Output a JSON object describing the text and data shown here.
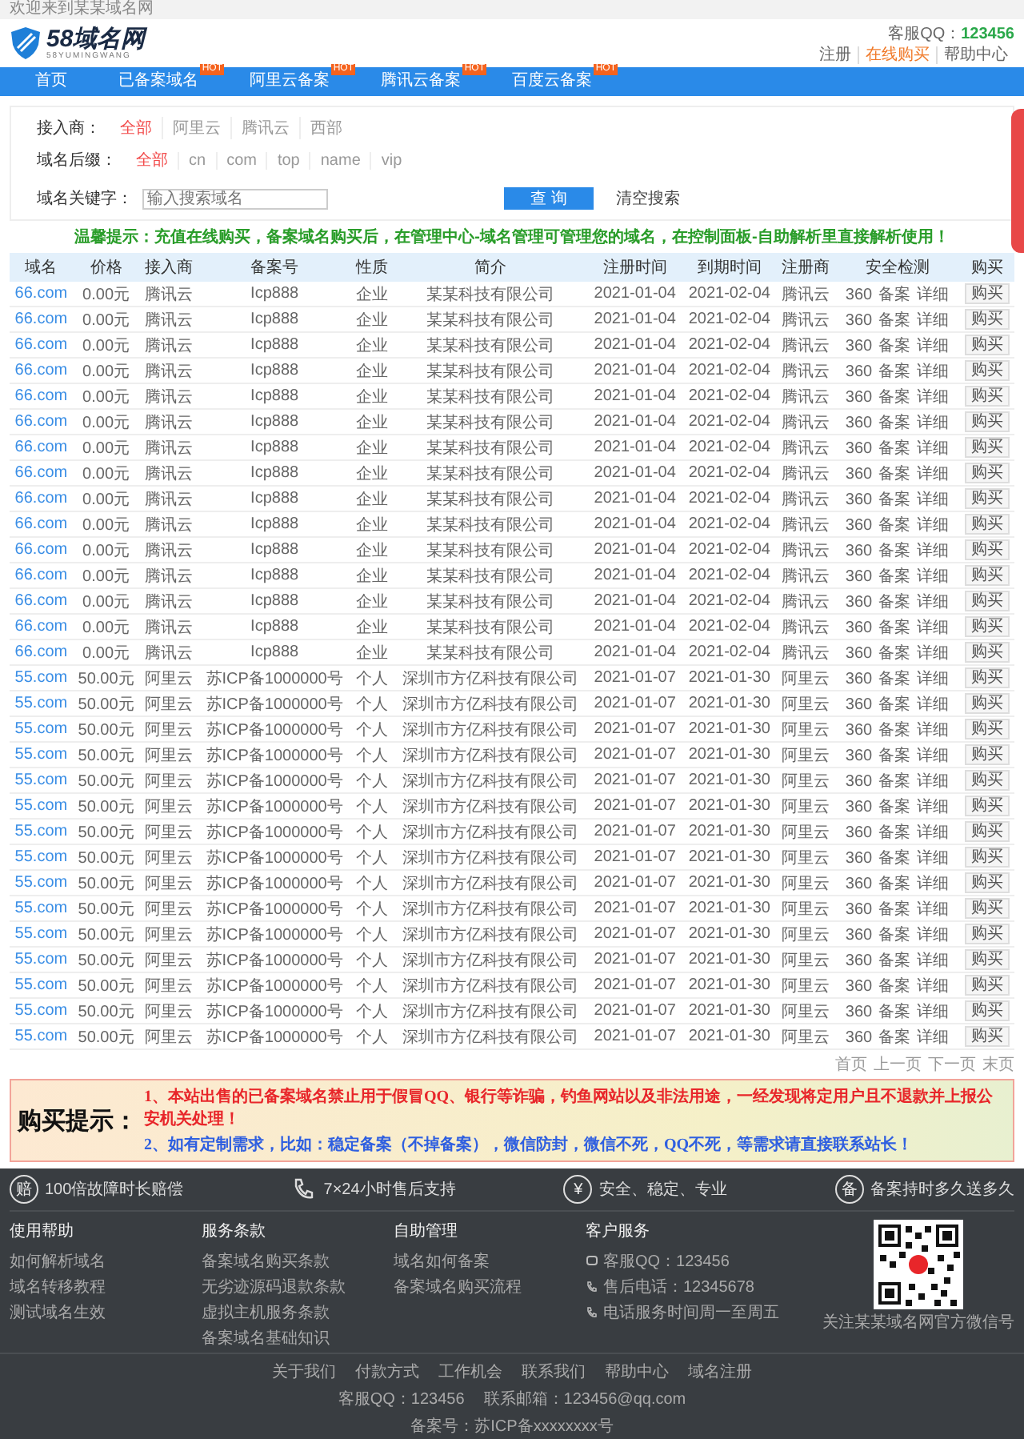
{
  "top_bar": {
    "welcome": "欢迎来到某某域名网"
  },
  "header": {
    "logo_text": "58域名网",
    "logo_sub": "58YUMINGWANG",
    "qq_label": "客服QQ：",
    "qq": "123456",
    "links": [
      {
        "label": "注册",
        "highlight": false
      },
      {
        "label": "在线购买",
        "highlight": true
      },
      {
        "label": "帮助中心",
        "highlight": false
      }
    ]
  },
  "nav": [
    {
      "label": "首页"
    },
    {
      "label": "已备案域名",
      "badge": "HOT"
    },
    {
      "label": "阿里云备案",
      "badge": "HOT"
    },
    {
      "label": "腾讯云备案",
      "badge": "HOT"
    },
    {
      "label": "百度云备案",
      "badge": "HOT"
    }
  ],
  "filters": [
    {
      "label": "接入商：",
      "options": [
        {
          "label": "全部",
          "selected": true
        },
        {
          "label": "阿里云",
          "selected": false
        },
        {
          "label": "腾讯云",
          "selected": false
        },
        {
          "label": "西部",
          "selected": false
        }
      ]
    },
    {
      "label": "域名后缀：",
      "options": [
        {
          "label": "全部",
          "selected": true
        },
        {
          "label": "cn",
          "selected": false
        },
        {
          "label": "com",
          "selected": false
        },
        {
          "label": "top",
          "selected": false
        },
        {
          "label": "name",
          "selected": false
        },
        {
          "label": "vip",
          "selected": false
        }
      ]
    }
  ],
  "search": {
    "label": "域名关键字：",
    "placeholder": "输入搜索域名",
    "button": "查 询",
    "clear": "清空搜索"
  },
  "notice": "温馨提示：充值在线购买，备案域名购买后，在管理中心-域名管理可管理您的域名，在控制面板-自助解析里直接解析使用！",
  "table": {
    "columns": [
      "域名",
      "价格",
      "接入商",
      "备案号",
      "性质",
      "简介",
      "注册时间",
      "到期时间",
      "注册商",
      "安全检测",
      "购买"
    ],
    "rows": [
      {
        "domain": "66.com",
        "price": "0.00元",
        "provider": "腾讯云",
        "icp": "Icp888",
        "type": "企业",
        "intro": "某某科技有限公司",
        "reg": "2021-01-04",
        "exp": "2021-02-04",
        "registrar": "腾讯云",
        "checks": [
          "360",
          "备案",
          "详细"
        ],
        "buy": "购买"
      },
      {
        "domain": "66.com",
        "price": "0.00元",
        "provider": "腾讯云",
        "icp": "Icp888",
        "type": "企业",
        "intro": "某某科技有限公司",
        "reg": "2021-01-04",
        "exp": "2021-02-04",
        "registrar": "腾讯云",
        "checks": [
          "360",
          "备案",
          "详细"
        ],
        "buy": "购买"
      },
      {
        "domain": "66.com",
        "price": "0.00元",
        "provider": "腾讯云",
        "icp": "Icp888",
        "type": "企业",
        "intro": "某某科技有限公司",
        "reg": "2021-01-04",
        "exp": "2021-02-04",
        "registrar": "腾讯云",
        "checks": [
          "360",
          "备案",
          "详细"
        ],
        "buy": "购买"
      },
      {
        "domain": "66.com",
        "price": "0.00元",
        "provider": "腾讯云",
        "icp": "Icp888",
        "type": "企业",
        "intro": "某某科技有限公司",
        "reg": "2021-01-04",
        "exp": "2021-02-04",
        "registrar": "腾讯云",
        "checks": [
          "360",
          "备案",
          "详细"
        ],
        "buy": "购买"
      },
      {
        "domain": "66.com",
        "price": "0.00元",
        "provider": "腾讯云",
        "icp": "Icp888",
        "type": "企业",
        "intro": "某某科技有限公司",
        "reg": "2021-01-04",
        "exp": "2021-02-04",
        "registrar": "腾讯云",
        "checks": [
          "360",
          "备案",
          "详细"
        ],
        "buy": "购买"
      },
      {
        "domain": "66.com",
        "price": "0.00元",
        "provider": "腾讯云",
        "icp": "Icp888",
        "type": "企业",
        "intro": "某某科技有限公司",
        "reg": "2021-01-04",
        "exp": "2021-02-04",
        "registrar": "腾讯云",
        "checks": [
          "360",
          "备案",
          "详细"
        ],
        "buy": "购买"
      },
      {
        "domain": "66.com",
        "price": "0.00元",
        "provider": "腾讯云",
        "icp": "Icp888",
        "type": "企业",
        "intro": "某某科技有限公司",
        "reg": "2021-01-04",
        "exp": "2021-02-04",
        "registrar": "腾讯云",
        "checks": [
          "360",
          "备案",
          "详细"
        ],
        "buy": "购买"
      },
      {
        "domain": "66.com",
        "price": "0.00元",
        "provider": "腾讯云",
        "icp": "Icp888",
        "type": "企业",
        "intro": "某某科技有限公司",
        "reg": "2021-01-04",
        "exp": "2021-02-04",
        "registrar": "腾讯云",
        "checks": [
          "360",
          "备案",
          "详细"
        ],
        "buy": "购买"
      },
      {
        "domain": "66.com",
        "price": "0.00元",
        "provider": "腾讯云",
        "icp": "Icp888",
        "type": "企业",
        "intro": "某某科技有限公司",
        "reg": "2021-01-04",
        "exp": "2021-02-04",
        "registrar": "腾讯云",
        "checks": [
          "360",
          "备案",
          "详细"
        ],
        "buy": "购买"
      },
      {
        "domain": "66.com",
        "price": "0.00元",
        "provider": "腾讯云",
        "icp": "Icp888",
        "type": "企业",
        "intro": "某某科技有限公司",
        "reg": "2021-01-04",
        "exp": "2021-02-04",
        "registrar": "腾讯云",
        "checks": [
          "360",
          "备案",
          "详细"
        ],
        "buy": "购买"
      },
      {
        "domain": "66.com",
        "price": "0.00元",
        "provider": "腾讯云",
        "icp": "Icp888",
        "type": "企业",
        "intro": "某某科技有限公司",
        "reg": "2021-01-04",
        "exp": "2021-02-04",
        "registrar": "腾讯云",
        "checks": [
          "360",
          "备案",
          "详细"
        ],
        "buy": "购买"
      },
      {
        "domain": "66.com",
        "price": "0.00元",
        "provider": "腾讯云",
        "icp": "Icp888",
        "type": "企业",
        "intro": "某某科技有限公司",
        "reg": "2021-01-04",
        "exp": "2021-02-04",
        "registrar": "腾讯云",
        "checks": [
          "360",
          "备案",
          "详细"
        ],
        "buy": "购买"
      },
      {
        "domain": "66.com",
        "price": "0.00元",
        "provider": "腾讯云",
        "icp": "Icp888",
        "type": "企业",
        "intro": "某某科技有限公司",
        "reg": "2021-01-04",
        "exp": "2021-02-04",
        "registrar": "腾讯云",
        "checks": [
          "360",
          "备案",
          "详细"
        ],
        "buy": "购买"
      },
      {
        "domain": "66.com",
        "price": "0.00元",
        "provider": "腾讯云",
        "icp": "Icp888",
        "type": "企业",
        "intro": "某某科技有限公司",
        "reg": "2021-01-04",
        "exp": "2021-02-04",
        "registrar": "腾讯云",
        "checks": [
          "360",
          "备案",
          "详细"
        ],
        "buy": "购买"
      },
      {
        "domain": "66.com",
        "price": "0.00元",
        "provider": "腾讯云",
        "icp": "Icp888",
        "type": "企业",
        "intro": "某某科技有限公司",
        "reg": "2021-01-04",
        "exp": "2021-02-04",
        "registrar": "腾讯云",
        "checks": [
          "360",
          "备案",
          "详细"
        ],
        "buy": "购买"
      },
      {
        "domain": "55.com",
        "price": "50.00元",
        "provider": "阿里云",
        "icp": "苏ICP备1000000号",
        "type": "个人",
        "intro": "深圳市方亿科技有限公司",
        "reg": "2021-01-07",
        "exp": "2021-01-30",
        "registrar": "阿里云",
        "checks": [
          "360",
          "备案",
          "详细"
        ],
        "buy": "购买"
      },
      {
        "domain": "55.com",
        "price": "50.00元",
        "provider": "阿里云",
        "icp": "苏ICP备1000000号",
        "type": "个人",
        "intro": "深圳市方亿科技有限公司",
        "reg": "2021-01-07",
        "exp": "2021-01-30",
        "registrar": "阿里云",
        "checks": [
          "360",
          "备案",
          "详细"
        ],
        "buy": "购买"
      },
      {
        "domain": "55.com",
        "price": "50.00元",
        "provider": "阿里云",
        "icp": "苏ICP备1000000号",
        "type": "个人",
        "intro": "深圳市方亿科技有限公司",
        "reg": "2021-01-07",
        "exp": "2021-01-30",
        "registrar": "阿里云",
        "checks": [
          "360",
          "备案",
          "详细"
        ],
        "buy": "购买"
      },
      {
        "domain": "55.com",
        "price": "50.00元",
        "provider": "阿里云",
        "icp": "苏ICP备1000000号",
        "type": "个人",
        "intro": "深圳市方亿科技有限公司",
        "reg": "2021-01-07",
        "exp": "2021-01-30",
        "registrar": "阿里云",
        "checks": [
          "360",
          "备案",
          "详细"
        ],
        "buy": "购买"
      },
      {
        "domain": "55.com",
        "price": "50.00元",
        "provider": "阿里云",
        "icp": "苏ICP备1000000号",
        "type": "个人",
        "intro": "深圳市方亿科技有限公司",
        "reg": "2021-01-07",
        "exp": "2021-01-30",
        "registrar": "阿里云",
        "checks": [
          "360",
          "备案",
          "详细"
        ],
        "buy": "购买"
      },
      {
        "domain": "55.com",
        "price": "50.00元",
        "provider": "阿里云",
        "icp": "苏ICP备1000000号",
        "type": "个人",
        "intro": "深圳市方亿科技有限公司",
        "reg": "2021-01-07",
        "exp": "2021-01-30",
        "registrar": "阿里云",
        "checks": [
          "360",
          "备案",
          "详细"
        ],
        "buy": "购买"
      },
      {
        "domain": "55.com",
        "price": "50.00元",
        "provider": "阿里云",
        "icp": "苏ICP备1000000号",
        "type": "个人",
        "intro": "深圳市方亿科技有限公司",
        "reg": "2021-01-07",
        "exp": "2021-01-30",
        "registrar": "阿里云",
        "checks": [
          "360",
          "备案",
          "详细"
        ],
        "buy": "购买"
      },
      {
        "domain": "55.com",
        "price": "50.00元",
        "provider": "阿里云",
        "icp": "苏ICP备1000000号",
        "type": "个人",
        "intro": "深圳市方亿科技有限公司",
        "reg": "2021-01-07",
        "exp": "2021-01-30",
        "registrar": "阿里云",
        "checks": [
          "360",
          "备案",
          "详细"
        ],
        "buy": "购买"
      },
      {
        "domain": "55.com",
        "price": "50.00元",
        "provider": "阿里云",
        "icp": "苏ICP备1000000号",
        "type": "个人",
        "intro": "深圳市方亿科技有限公司",
        "reg": "2021-01-07",
        "exp": "2021-01-30",
        "registrar": "阿里云",
        "checks": [
          "360",
          "备案",
          "详细"
        ],
        "buy": "购买"
      },
      {
        "domain": "55.com",
        "price": "50.00元",
        "provider": "阿里云",
        "icp": "苏ICP备1000000号",
        "type": "个人",
        "intro": "深圳市方亿科技有限公司",
        "reg": "2021-01-07",
        "exp": "2021-01-30",
        "registrar": "阿里云",
        "checks": [
          "360",
          "备案",
          "详细"
        ],
        "buy": "购买"
      },
      {
        "domain": "55.com",
        "price": "50.00元",
        "provider": "阿里云",
        "icp": "苏ICP备1000000号",
        "type": "个人",
        "intro": "深圳市方亿科技有限公司",
        "reg": "2021-01-07",
        "exp": "2021-01-30",
        "registrar": "阿里云",
        "checks": [
          "360",
          "备案",
          "详细"
        ],
        "buy": "购买"
      },
      {
        "domain": "55.com",
        "price": "50.00元",
        "provider": "阿里云",
        "icp": "苏ICP备1000000号",
        "type": "个人",
        "intro": "深圳市方亿科技有限公司",
        "reg": "2021-01-07",
        "exp": "2021-01-30",
        "registrar": "阿里云",
        "checks": [
          "360",
          "备案",
          "详细"
        ],
        "buy": "购买"
      },
      {
        "domain": "55.com",
        "price": "50.00元",
        "provider": "阿里云",
        "icp": "苏ICP备1000000号",
        "type": "个人",
        "intro": "深圳市方亿科技有限公司",
        "reg": "2021-01-07",
        "exp": "2021-01-30",
        "registrar": "阿里云",
        "checks": [
          "360",
          "备案",
          "详细"
        ],
        "buy": "购买"
      },
      {
        "domain": "55.com",
        "price": "50.00元",
        "provider": "阿里云",
        "icp": "苏ICP备1000000号",
        "type": "个人",
        "intro": "深圳市方亿科技有限公司",
        "reg": "2021-01-07",
        "exp": "2021-01-30",
        "registrar": "阿里云",
        "checks": [
          "360",
          "备案",
          "详细"
        ],
        "buy": "购买"
      },
      {
        "domain": "55.com",
        "price": "50.00元",
        "provider": "阿里云",
        "icp": "苏ICP备1000000号",
        "type": "个人",
        "intro": "深圳市方亿科技有限公司",
        "reg": "2021-01-07",
        "exp": "2021-01-30",
        "registrar": "阿里云",
        "checks": [
          "360",
          "备案",
          "详细"
        ],
        "buy": "购买"
      }
    ]
  },
  "pagination": [
    "首页",
    "上一页",
    "下一页",
    "末页"
  ],
  "purchase_notice": {
    "title": "购买提示：",
    "lines": [
      {
        "text": "1、本站出售的已备案域名禁止用于假冒QQ、银行等诈骗，钓鱼网站以及非法用途，一经发现将定用户且不退款并上报公安机关处理！",
        "color": "#e8262a"
      },
      {
        "text": "2、如有定制需求，比如：稳定备案（不掉备案），微信防封，微信不死，QQ不死，等需求请直接联系站长！",
        "color": "#2f5fe0"
      }
    ]
  },
  "features": [
    {
      "kind": "glyph",
      "icon": "赔",
      "label": "100倍故障时长赔偿"
    },
    {
      "kind": "phone",
      "label": "7×24小时售后支持"
    },
    {
      "kind": "glyph",
      "icon": "¥",
      "label": "安全、稳定、专业"
    },
    {
      "kind": "glyph",
      "icon": "备",
      "label": "备案持时多久送多久"
    }
  ],
  "footer_columns": [
    {
      "title": "使用帮助",
      "links": [
        "如何解析域名",
        "域名转移教程",
        "测试域名生效"
      ]
    },
    {
      "title": "服务条款",
      "links": [
        "备案域名购买条款",
        "无劣迹源码退款条款",
        "虚拟主机服务条款",
        "备案域名基础知识"
      ]
    },
    {
      "title": "自助管理",
      "links": [
        "域名如何备案",
        "备案域名购买流程"
      ]
    }
  ],
  "contact": {
    "title": "客户服务",
    "items": [
      {
        "kind": "qq",
        "text": "客服QQ：123456"
      },
      {
        "kind": "phone",
        "text": "售后电话：12345678"
      },
      {
        "kind": "phone",
        "text": "电话服务时间周一至周五"
      }
    ]
  },
  "qr_caption": "关注某某域名网官方微信号",
  "bottom_links": [
    "关于我们",
    "付款方式",
    "工作机会",
    "联系我们",
    "帮助中心",
    "域名注册"
  ],
  "bottom_contact": [
    "客服QQ：123456",
    "联系邮箱：123456@qq.com"
  ],
  "record": "备案号：苏ICP备xxxxxxxx号"
}
